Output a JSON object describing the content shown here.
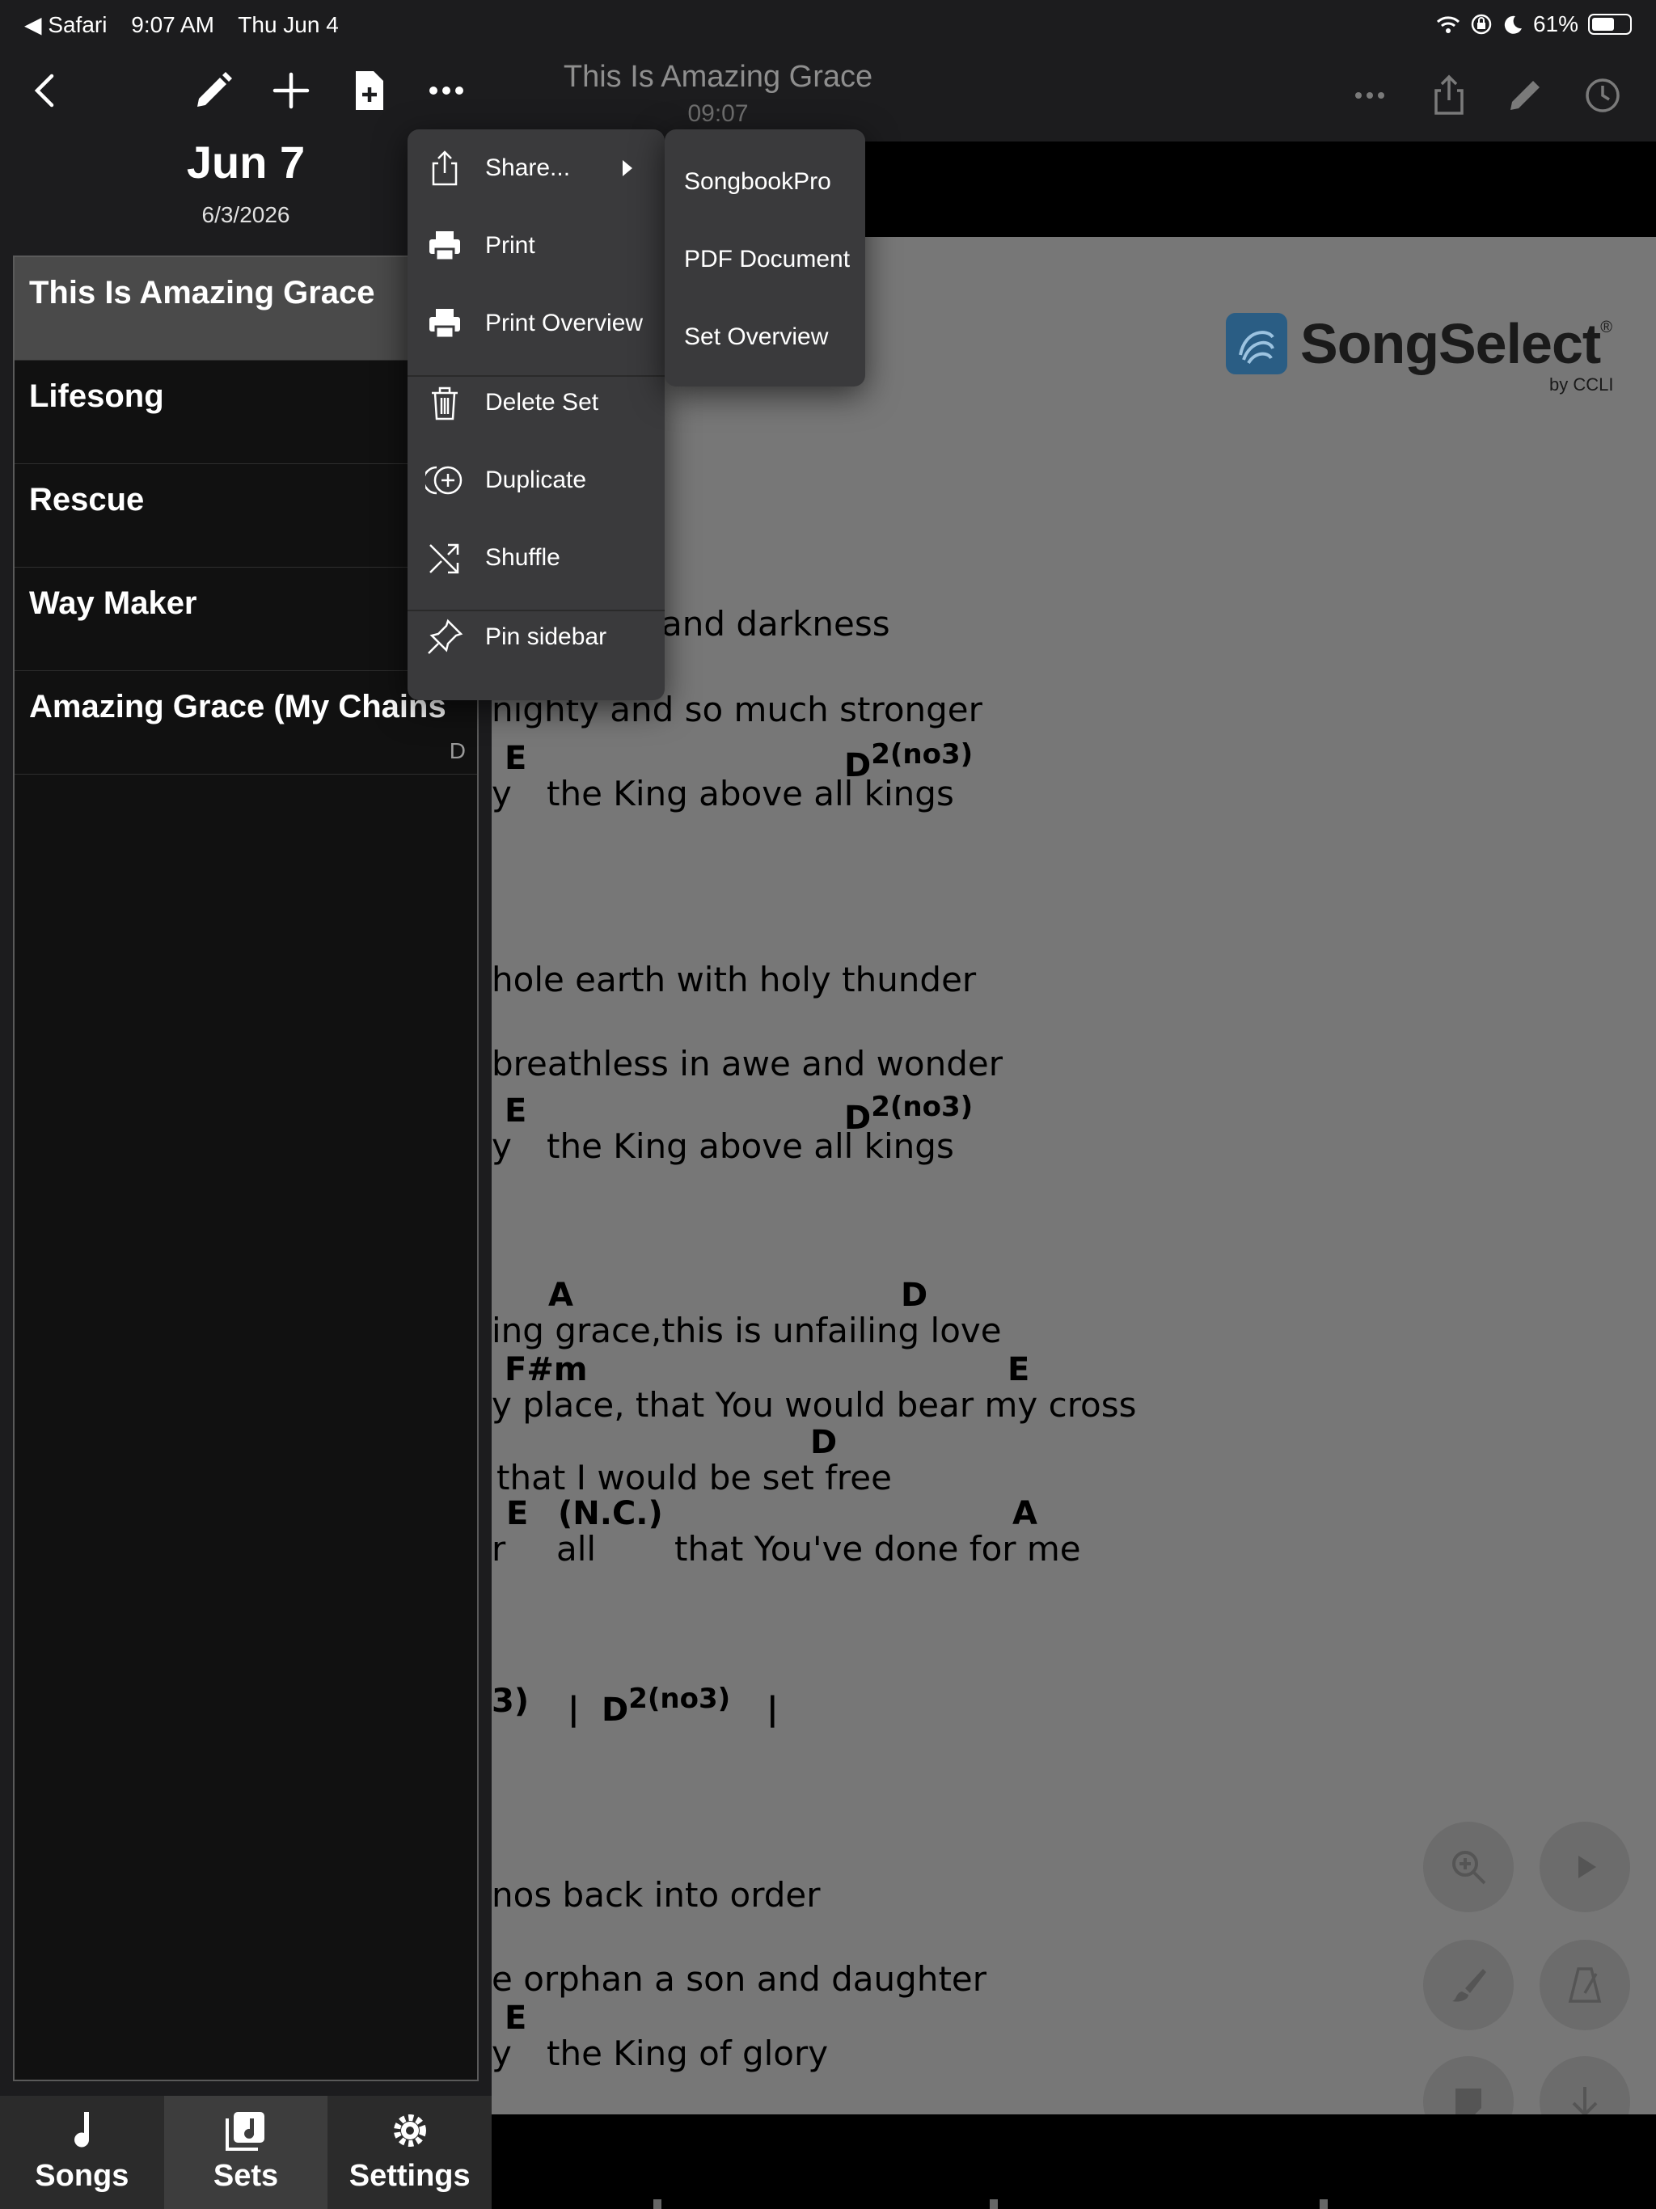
{
  "status_bar": {
    "back_app": "◀ Safari",
    "time": "9:07 AM",
    "date": "Thu Jun 4",
    "battery": "61%",
    "battery_level": 0.61
  },
  "sidebar": {
    "title": "Jun 7",
    "date": "6/3/2026",
    "songs": [
      {
        "name": "This Is Amazing Grace",
        "key": ""
      },
      {
        "name": "Lifesong",
        "key": ""
      },
      {
        "name": "Rescue",
        "key": ""
      },
      {
        "name": "Way Maker",
        "key": ""
      },
      {
        "name": "Amazing Grace (My Chains",
        "key": "D"
      }
    ],
    "tabs": [
      {
        "label": "Songs"
      },
      {
        "label": "Sets"
      },
      {
        "label": "Settings"
      }
    ]
  },
  "song_view": {
    "title": "This Is Amazing Grace",
    "time": "09:07",
    "logo_text": "SongSelect",
    "logo_reg": "®",
    "logo_sub": "by CCLI",
    "lyrics": [
      "and darkness",
      "nighty and so much stronger",
      "y",
      "the King above all kings",
      "hole earth with holy thunder",
      "breathless in awe and wonder",
      "y",
      "the King above all kings",
      "ing grace,this is unfailing love",
      "y place, that You would bear my cross",
      "that I would be set free",
      "r",
      "all",
      "that You've done for me",
      "nos back into order",
      "e orphan a son and daughter",
      "y",
      "the King of glory"
    ],
    "chords": {
      "e1": "E",
      "d1": "D",
      "d1_sup": "2(no3)",
      "e2": "E",
      "d2": "D",
      "d2_sup": "2(no3)",
      "a1": "A",
      "d3": "D",
      "fsm": "F#m",
      "e3": "E",
      "d4": "D",
      "e4": "E",
      "nc": "(N.C.)",
      "a2": "A",
      "bar_frag": "3)",
      "bar1": "|",
      "d5": "D",
      "d5_sup": "2(no3)",
      "bar2": "|",
      "e5": "E"
    }
  },
  "menu": {
    "items": [
      {
        "label": "Share..."
      },
      {
        "label": "Print"
      },
      {
        "label": "Print Overview"
      },
      {
        "label": "Delete Set"
      },
      {
        "label": "Duplicate"
      },
      {
        "label": "Shuffle"
      },
      {
        "label": "Pin sidebar"
      }
    ],
    "share_submenu": [
      {
        "label": "SongbookPro"
      },
      {
        "label": "PDF Document"
      },
      {
        "label": "Set Overview"
      }
    ]
  }
}
